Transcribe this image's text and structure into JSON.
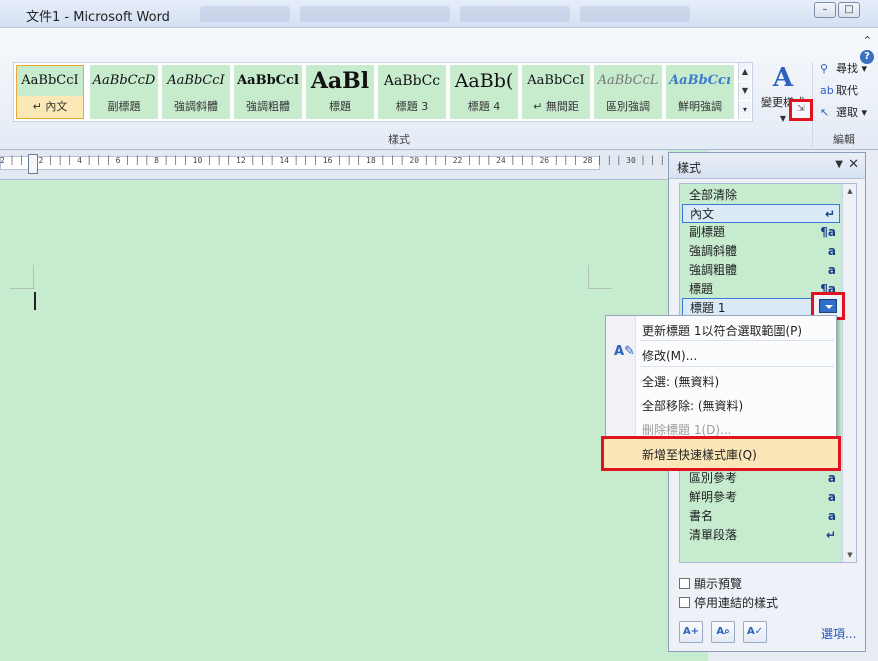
{
  "window": {
    "title": "文件1 - Microsoft Word"
  },
  "ribbon": {
    "styles_gallery": [
      {
        "sample": "AaBbCcI",
        "name": "↵ 內文",
        "selected": true
      },
      {
        "sample": "AaBbCcD",
        "name": "副標題"
      },
      {
        "sample": "AaBbCcI",
        "name": "強調斜體"
      },
      {
        "sample": "AaBbCcl",
        "name": "強調粗體"
      },
      {
        "sample": "AaBl",
        "name": "標題"
      },
      {
        "sample": "AaBbCc",
        "name": "標題 3"
      },
      {
        "sample": "AaBb(",
        "name": "標題 4"
      },
      {
        "sample": "AaBbCcI",
        "name": "↵ 無間距"
      },
      {
        "sample": "AaBbCcL",
        "name": "區別強調"
      },
      {
        "sample": "AaBbCcı",
        "name": "鮮明強調"
      }
    ],
    "styles_group_label": "樣式",
    "change_styles_label": "變更樣式",
    "change_styles_glyph": "A",
    "editing_group_label": "編輯",
    "find_label": "尋找",
    "replace_label": "取代",
    "select_label": "選取"
  },
  "ruler": {
    "scale": "2 │ │ │ 2 │ │ │ 4 │ │ │ 6 │ │ │ 8 │ │ │ 10 │ │ │ 12 │ │ │ 14 │ │ │ 16 │ │ │ 18 │ │ │ 20 │ │ │ 22 │ │ │ 24 │ │ │ 26 │ │ │ 28 │ │ │ 30 │ │ │ 32 │ │ │ 34 │ │ │ 36 │ │ │ 38"
  },
  "styles_pane": {
    "title": "樣式",
    "items": [
      {
        "label": "全部清除",
        "type": ""
      },
      {
        "label": "內文",
        "type": "↵"
      },
      {
        "label": "副標題",
        "type": "¶a"
      },
      {
        "label": "強調斜體",
        "type": "a"
      },
      {
        "label": "強調粗體",
        "type": "a"
      },
      {
        "label": "標題",
        "type": "¶a"
      },
      {
        "label": "標題 1",
        "type": ""
      },
      {
        "label": "區別參考",
        "type": "a"
      },
      {
        "label": "鮮明參考",
        "type": "a"
      },
      {
        "label": "書名",
        "type": "a"
      },
      {
        "label": "清單段落",
        "type": "↵"
      }
    ],
    "show_preview_label": "顯示預覽",
    "disable_linked_label": "停用連結的樣式",
    "options_link": "選項..."
  },
  "context_menu": {
    "update_label": "更新標題 1以符合選取範圍(P)",
    "modify_label": "修改(M)...",
    "select_all_label": "全選: (無資料)",
    "remove_all_label": "全部移除: (無資料)",
    "delete_label": "刪除標題 1(D)...",
    "add_to_gallery_label": "新增至快速樣式庫(Q)"
  }
}
